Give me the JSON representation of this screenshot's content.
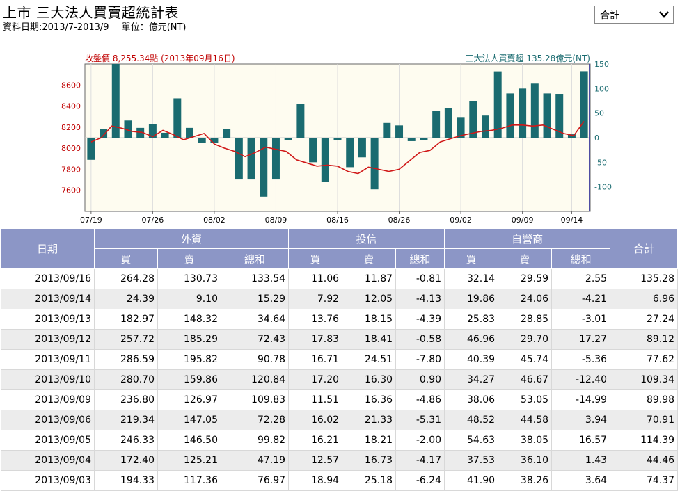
{
  "page": {
    "title": "上市 三大法人買賣超統計表",
    "date_range": "資料日期:2013/7-2013/9",
    "unit": "單位：億元(NT)",
    "select_value": "合計"
  },
  "chart_data": {
    "type": "bar",
    "left_caption": "收盤價 8,255.34點 (2013年09月16日)",
    "right_caption": "三大法人買賣超 135.28億元(NT)",
    "x_tick_labels": [
      "07/19",
      "07/26",
      "08/02",
      "08/09",
      "08/16",
      "08/26",
      "09/02",
      "09/09",
      "09/14"
    ],
    "x_tick_index": [
      0,
      5,
      10,
      15,
      20,
      25,
      30,
      35,
      39
    ],
    "left_axis": {
      "ticks": [
        8600,
        8400,
        8200,
        8000,
        7800,
        7600
      ],
      "ylim": [
        7400,
        8800
      ]
    },
    "right_axis": {
      "ticks": [
        150,
        100,
        50,
        0,
        -50,
        -100
      ],
      "ylim": [
        -150,
        150
      ]
    },
    "series": [
      {
        "name": "三大法人買賣超",
        "color": "#1a6b70",
        "values": [
          -45,
          17,
          150,
          35,
          20,
          27,
          10,
          80,
          20,
          -10,
          -10,
          17,
          -85,
          -85,
          -120,
          -85,
          -5,
          68,
          -50,
          -90,
          -5,
          -60,
          -40,
          -105,
          30,
          25,
          -7,
          -5,
          55,
          60,
          42,
          75,
          45,
          135,
          90,
          100,
          110,
          90,
          89.12,
          6.96,
          135.28
        ]
      },
      {
        "name": "收盤價",
        "color": "#d01818",
        "values": [
          8060,
          8100,
          8210,
          8190,
          8160,
          8150,
          8110,
          8170,
          8130,
          8080,
          8110,
          8140,
          8040,
          8000,
          7970,
          7920,
          7960,
          8010,
          7990,
          7970,
          7890,
          7860,
          7830,
          7840,
          7830,
          7780,
          7760,
          7820,
          7800,
          7780,
          7800,
          7880,
          7960,
          7980,
          8060,
          8090,
          8120,
          8140,
          8160,
          8170,
          8190,
          8220,
          8220,
          8210,
          8220,
          8180,
          8140,
          8120,
          8255.34
        ]
      }
    ]
  },
  "table": {
    "headers": {
      "date": "日期",
      "groups": [
        "外資",
        "投信",
        "自營商"
      ],
      "sub": [
        "買",
        "賣",
        "總和"
      ],
      "total": "合計"
    },
    "rows": [
      [
        "2013/09/16",
        "264.28",
        "130.73",
        "133.54",
        "11.06",
        "11.87",
        "-0.81",
        "32.14",
        "29.59",
        "2.55",
        "135.28"
      ],
      [
        "2013/09/14",
        "24.39",
        "9.10",
        "15.29",
        "7.92",
        "12.05",
        "-4.13",
        "19.86",
        "24.06",
        "-4.21",
        "6.96"
      ],
      [
        "2013/09/13",
        "182.97",
        "148.32",
        "34.64",
        "13.76",
        "18.15",
        "-4.39",
        "25.83",
        "28.85",
        "-3.01",
        "27.24"
      ],
      [
        "2013/09/12",
        "257.72",
        "185.29",
        "72.43",
        "17.83",
        "18.41",
        "-0.58",
        "46.96",
        "29.70",
        "17.27",
        "89.12"
      ],
      [
        "2013/09/11",
        "286.59",
        "195.82",
        "90.78",
        "16.71",
        "24.51",
        "-7.80",
        "40.39",
        "45.74",
        "-5.36",
        "77.62"
      ],
      [
        "2013/09/10",
        "280.70",
        "159.86",
        "120.84",
        "17.20",
        "16.30",
        "0.90",
        "34.27",
        "46.67",
        "-12.40",
        "109.34"
      ],
      [
        "2013/09/09",
        "236.80",
        "126.97",
        "109.83",
        "11.51",
        "16.36",
        "-4.86",
        "38.06",
        "53.05",
        "-14.99",
        "89.98"
      ],
      [
        "2013/09/06",
        "219.34",
        "147.05",
        "72.28",
        "16.02",
        "21.33",
        "-5.31",
        "48.52",
        "44.58",
        "3.94",
        "70.91"
      ],
      [
        "2013/09/05",
        "246.33",
        "146.50",
        "99.82",
        "16.21",
        "18.21",
        "-2.00",
        "54.63",
        "38.05",
        "16.57",
        "114.39"
      ],
      [
        "2013/09/04",
        "172.40",
        "125.21",
        "47.19",
        "12.57",
        "16.73",
        "-4.17",
        "37.53",
        "36.10",
        "1.43",
        "44.46"
      ],
      [
        "2013/09/03",
        "194.33",
        "117.36",
        "76.97",
        "18.94",
        "25.18",
        "-6.24",
        "41.90",
        "38.26",
        "3.64",
        "74.37"
      ]
    ]
  }
}
